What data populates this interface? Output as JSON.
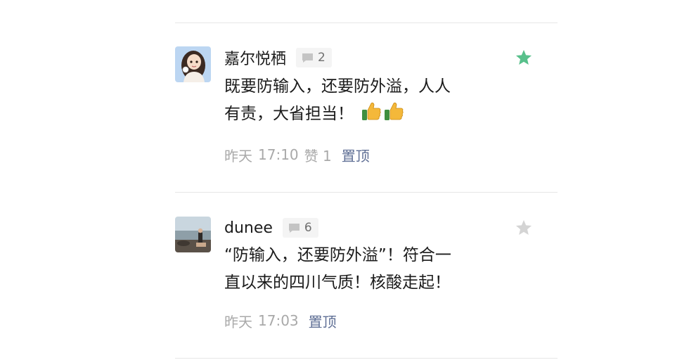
{
  "comments": [
    {
      "author": "嘉尔悦栖",
      "reply_count": "2",
      "content_lines": [
        "既要防输入，还要防外溢，人人",
        "有责，大省担当！"
      ],
      "emoji": "thumbs-up-icon",
      "date_label": "昨天",
      "time": "17:10",
      "likes": "赞 1",
      "pin_label": "置顶",
      "starred": true
    },
    {
      "author": "dunee",
      "reply_count": "6",
      "content_lines": [
        "“防输入，还要防外溢”！符合一",
        "直以来的四川气质！核酸走起！"
      ],
      "date_label": "昨天",
      "time": "17:03",
      "pin_label": "置顶",
      "starred": false
    }
  ],
  "colors": {
    "star_active": "#58c08b",
    "star_inactive": "#d4d4d4",
    "pin_link": "#5f6f95",
    "meta_text": "#a9a9a9"
  }
}
